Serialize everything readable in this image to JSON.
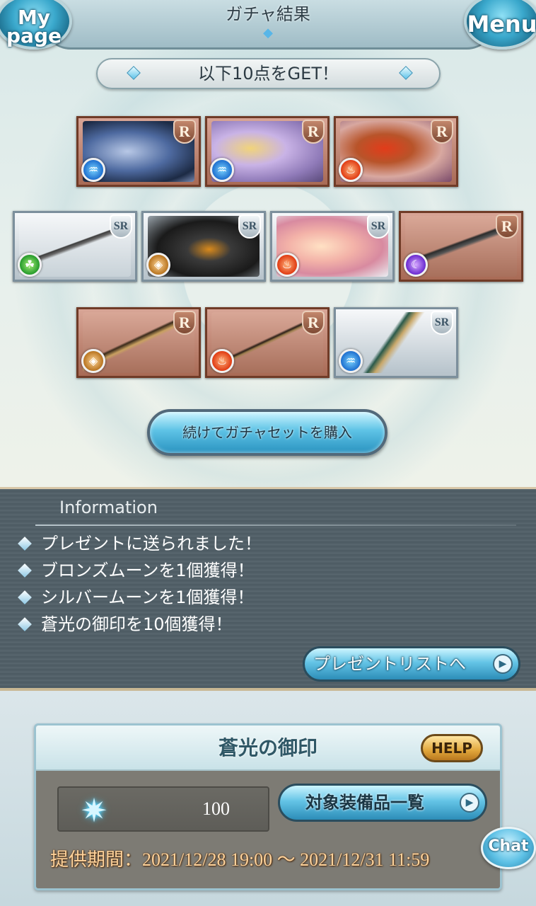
{
  "header": {
    "title": "ガチャ結果",
    "mypage_label": "My page",
    "menu_label": "Menu"
  },
  "result_banner": "以下10点をGET！",
  "cards": [
    {
      "rank": "R",
      "element": "water",
      "kind": "summon"
    },
    {
      "rank": "R",
      "element": "water",
      "kind": "summon"
    },
    {
      "rank": "R",
      "element": "fire",
      "kind": "summon"
    },
    {
      "rank": "SR",
      "element": "wind",
      "kind": "weapon"
    },
    {
      "rank": "SR",
      "element": "earth",
      "kind": "summon"
    },
    {
      "rank": "SR",
      "element": "fire",
      "kind": "summon"
    },
    {
      "rank": "R",
      "element": "dark",
      "kind": "weapon"
    },
    {
      "rank": "R",
      "element": "earth",
      "kind": "weapon"
    },
    {
      "rank": "R",
      "element": "fire",
      "kind": "weapon"
    },
    {
      "rank": "SR",
      "element": "water",
      "kind": "weapon"
    }
  ],
  "continue_button": "続けてガチャセットを購入",
  "information": {
    "heading": "Information",
    "items": [
      "プレゼントに送られました！",
      "ブロンズムーンを1個獲得！",
      "シルバームーンを1個獲得！",
      "蒼光の御印を10個獲得！"
    ],
    "present_button": "プレゼントリストへ"
  },
  "seal": {
    "title": "蒼光の御印",
    "help_label": "HELP",
    "count": "100",
    "equip_button": "対象装備品一覧",
    "period": "提供期間：2021/12/28 19:00 〜 2021/12/31 11:59"
  },
  "chat_label": "Chat",
  "colors": {
    "accent_blue": "#2a93c0",
    "info_bg": "#4c5a62",
    "period_text": "#ffd39b"
  }
}
